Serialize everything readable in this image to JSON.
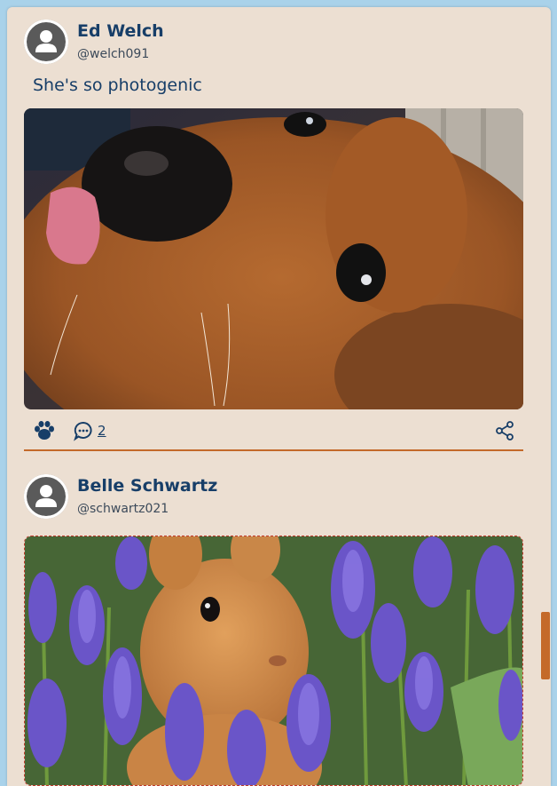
{
  "colors": {
    "accent": "#c46a2a",
    "name": "#173e68",
    "card": "#ecdfd2",
    "page": "#a9d2ea"
  },
  "posts": [
    {
      "author": "Ed Welch",
      "handle": "@welch091",
      "text": "She's so photogenic",
      "image_icon": "dog-photo",
      "comments": "2"
    },
    {
      "author": "Belle Schwartz",
      "handle": "@schwartz021",
      "image_icon": "bunny-photo"
    }
  ],
  "icons": {
    "paw": "paw-icon",
    "comment": "comment-icon",
    "share": "share-icon",
    "avatar": "user-avatar-icon"
  }
}
